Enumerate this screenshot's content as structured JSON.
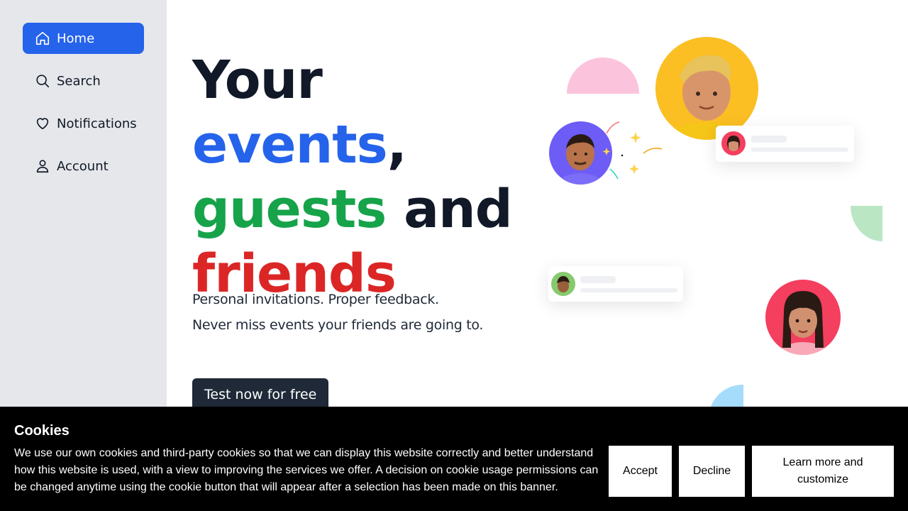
{
  "sidebar": {
    "items": [
      {
        "label": "Home",
        "icon": "home-icon",
        "active": true
      },
      {
        "label": "Search",
        "icon": "search-icon",
        "active": false
      },
      {
        "label": "Notifications",
        "icon": "heart-icon",
        "active": false
      },
      {
        "label": "Account",
        "icon": "user-icon",
        "active": false
      }
    ]
  },
  "hero": {
    "title_part1": "Your ",
    "title_events": "events",
    "title_comma": ",",
    "title_guests": "guests",
    "title_and": " and",
    "title_friends": "friends",
    "subtitle_line1": "Personal invitations. Proper feedback.",
    "subtitle_line2": "Never miss events your friends are going to.",
    "cta_label": "Test now for free"
  },
  "cookie_banner": {
    "title": "Cookies",
    "text": "We use our own cookies and third-party cookies so that we can display this website correctly and better understand how this website is used, with a view to improving the services we offer. A decision on cookie usage permissions can be changed anytime using the cookie button that will appear after a selection has been made on this banner.",
    "accept_label": "Accept",
    "decline_label": "Decline",
    "learn_more_label": "Learn more and customize"
  },
  "colors": {
    "accent_blue": "#2563eb",
    "accent_green": "#16a34a",
    "accent_red": "#dc2626",
    "sidebar_bg": "#e5e7eb",
    "cta_bg": "#1f2937"
  }
}
